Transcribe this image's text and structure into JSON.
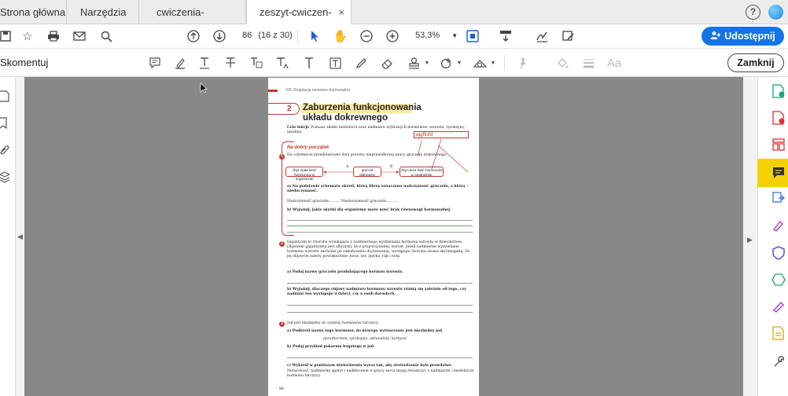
{
  "tabs": [
    {
      "label": "Strona główna"
    },
    {
      "label": "Narzędzia"
    },
    {
      "label": "cwiczenia-zintegro..."
    },
    {
      "label": "zeszyt-cwiczen-puls..."
    }
  ],
  "tab_close": "×",
  "help_icon": "?",
  "toolbar": {
    "page_current": "86",
    "page_total": "(16 z 30)",
    "zoom": "53,3%"
  },
  "share_label": "Udostępnij",
  "comment": {
    "title": "Skomentuj",
    "close_label": "Zamknij",
    "text_font_icon": "Aa"
  },
  "doc": {
    "header": "VIII. Regulacja nerwowo-hormonalna",
    "section_number": "2",
    "section_title_1": "Zaburzenia funkcjonowania",
    "section_title_2": "układu dokrewnego",
    "goal_label": "Cele lekcji:",
    "goal_text": "Poznasz skutki niedoboru oraz nadmiaru wybranych hormonów: wzrostu, tyroksyny, insuliny.",
    "annotation": "ajgffofd",
    "start_title": "Na dobry początek",
    "task1_number": "1",
    "task1_intro": "Na schemacie przedstawiono dwa procesy nieprawidłowej pracy gruczołu dokrewnego.",
    "diag_left": "zbyt mała ilość hormonów w organizmie",
    "diag_mid": "gruczoł dokrewny",
    "diag_right": "zbyt duża ilość hormonów w organizmie",
    "diag_label_a": "A",
    "diag_label_b": "B",
    "task1a": "a) Na podstawie schematu określ, którą literą oznaczono nadczynność gruczołu, a którą – niedoczynność.",
    "task1a_answer": "Nadczynność gruczołu: ........ Niedoczynność gruczołu: ........",
    "task1b": "b) Wyjaśnij, jakie skutki dla organizmu może mieć brak równowagi hormonalnej.",
    "task2_number": "2",
    "task2_text": "Gigantyzm to choroba wynikająca z nadmiernego wydzielania hormonu wzrostu w dzieciństwie. Objawem gigantyzmu jest olbrzymi, lecz proporcjonalny wzrost. Jeżeli nadmierne wydzielanie hormonu wzrostu zachodzi po zakończeniu dojrzewania, występuje choroba zwana akromegalią. Do jej objawów należy powiększenie: nosa, ust, języka, rąk i stóp.",
    "task2a": "a) Podaj nazwę gruczołu produkującego hormon wzrostu.",
    "task2b": "b) Wyjaśnij, dlaczego objawy nadmiaru hormonu wzrostu różnią się zależnie od tego, czy nadmiar ten występuje u dzieci, czy u osób dorosłych.",
    "task3_number": "3",
    "task3_text": "Jod jest niezbędny do syntezy hormonów tarczycy.",
    "task3a": "a) Podkreśl nazwę tego hormonu, do którego wytwarzania jest niezbędny jod.",
    "task3a_options": "parathormon, tyroksyna, adrenalina, kortyzol",
    "task3b": "b) Podaj przykład pokarmu bogatego w jod.",
    "task3c": "c) Wykreśl w poniższym stwierdzeniu wyraz tak, aby stwierdzenie było prawdziwe.",
    "task3c_text": "Nerwowość, nadmierny apetyt i nadkłocenie w pracy serca mogą świadczyć o nadmiarze / niedoborze hormonu tarczycy.",
    "page_number": "86"
  },
  "colors": {
    "accent": "#1473e6",
    "highlight": "#f5d000",
    "red": "#c0392b",
    "viewer_bg": "#888888"
  }
}
